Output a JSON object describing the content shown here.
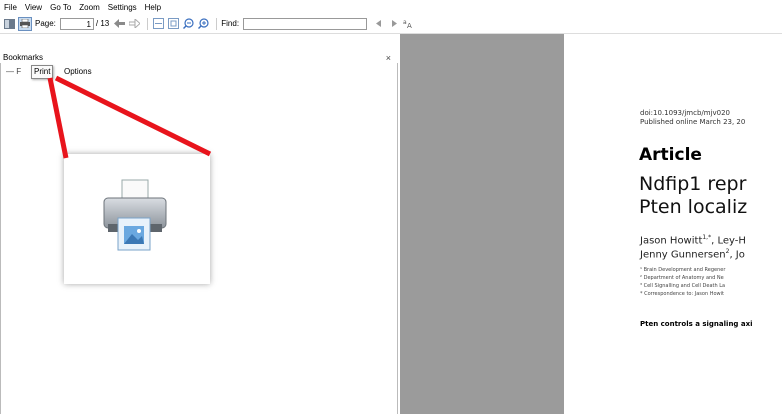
{
  "menu": [
    "File",
    "View",
    "Go To",
    "Zoom",
    "Settings",
    "Help"
  ],
  "toolbar": {
    "page_label": "Page:",
    "page_value": "1",
    "page_total": "/ 13",
    "find_label": "Find:"
  },
  "bookmarks": {
    "title": "Bookmarks",
    "options": "Options",
    "tooltip": "Print"
  },
  "pdf": {
    "doi": "doi:10.1093/jmcb/mjv020",
    "published": "Published online March 23, 20",
    "section": "Article",
    "title_line1": "Ndfip1 repr",
    "title_line2": "Pten localiz",
    "author1_name": "Jason Howitt",
    "author1_sup": "1,*",
    "author1_rest": ", Ley-H",
    "author2_name": "Jenny Gunnersen",
    "author2_sup": "2",
    "author2_rest": ", Jo",
    "affil1": "Brain Development and Regener",
    "affil2": "Department of Anatomy and Ne",
    "affil3": "Cell Signalling and Cell Death La",
    "affil4": "Correspondence to: Jason Howit",
    "abstract_start": "Pten controls a signaling axi"
  },
  "colors": {
    "arrow": "#e8141c",
    "viewer_bg": "#9b9b9b"
  }
}
